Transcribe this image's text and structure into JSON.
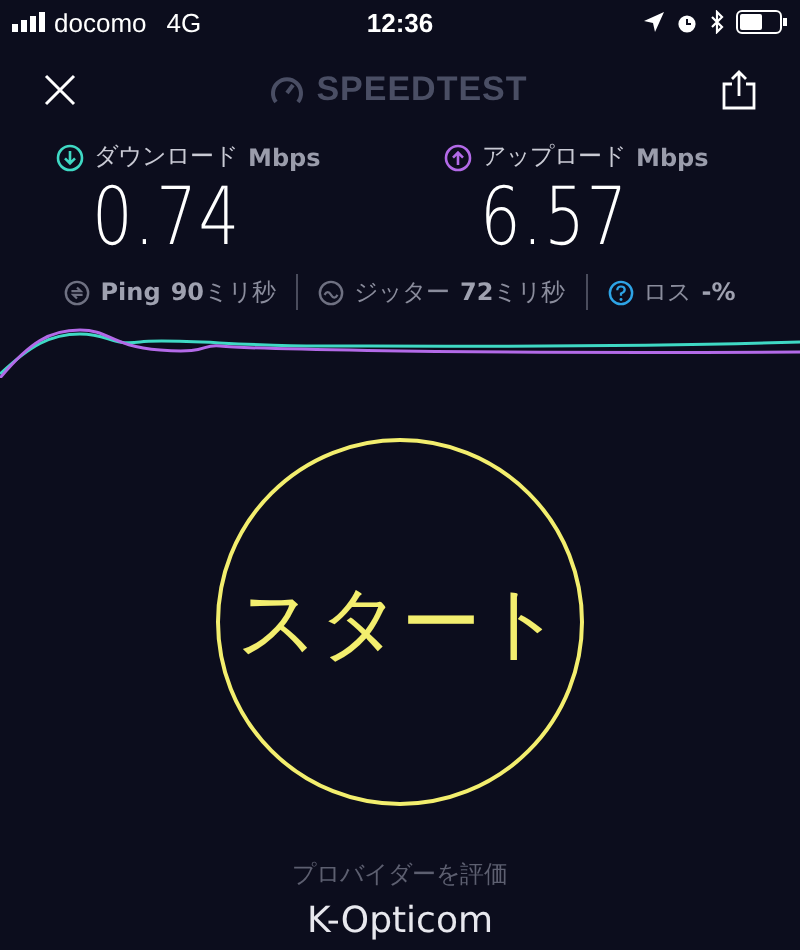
{
  "status_bar": {
    "carrier": "docomo",
    "network": "4G",
    "time": "12:36"
  },
  "header": {
    "title": "SPEEDTEST"
  },
  "results": [
    {
      "kind": "download",
      "label": "ダウンロード",
      "unit": "Mbps",
      "value": "0.74",
      "color": "#3fd9c4"
    },
    {
      "kind": "upload",
      "label": "アップロード",
      "unit": "Mbps",
      "value": "6.57",
      "color": "#b36ae8"
    }
  ],
  "stats": [
    {
      "kind": "ping",
      "label": "Ping",
      "value": "90",
      "unit": "ミリ秒"
    },
    {
      "kind": "jitter",
      "label": "ジッター",
      "value": "72",
      "unit": "ミリ秒"
    },
    {
      "kind": "loss",
      "label": "ロス",
      "value": "-%"
    }
  ],
  "start_button": {
    "label": "スタート"
  },
  "provider": {
    "prompt": "プロバイダーを評価",
    "name": "K-Opticom"
  }
}
